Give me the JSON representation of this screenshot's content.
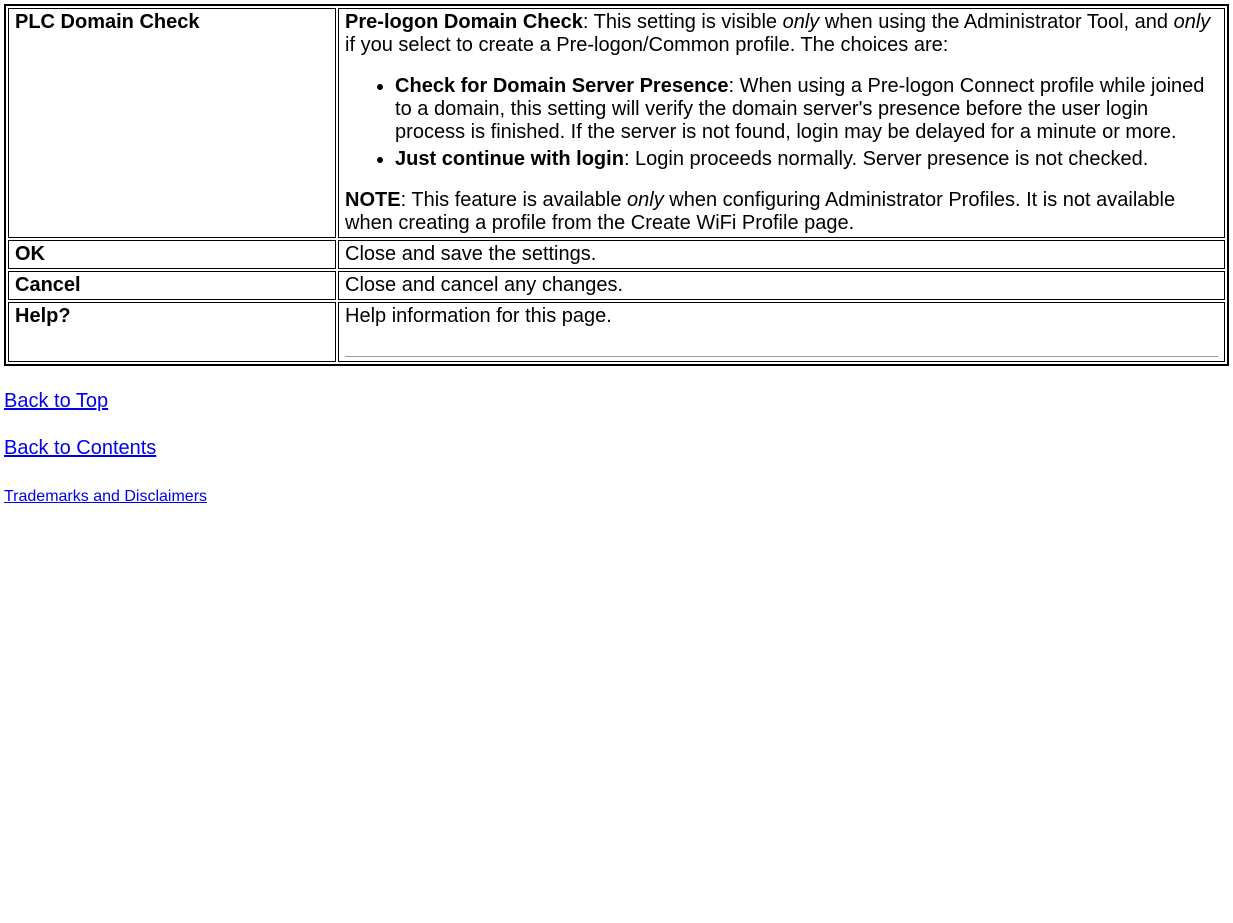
{
  "table": {
    "rows": [
      {
        "left": "PLC Domain Check",
        "right": {
          "intro_bold": "Pre-logon Domain Check",
          "intro_rest_a": ": This setting is visible ",
          "intro_only1": "only",
          "intro_rest_b": " when using the Administrator Tool, and ",
          "intro_only2": "only",
          "intro_rest_c": " if you select to create a Pre-logon/Common profile. The choices are:",
          "bullets": [
            {
              "bold": "Check for Domain Server Presence",
              "rest": ": When using a Pre-logon Connect profile while joined to a domain, this setting will verify the domain server's presence before the user login process is finished. If the server is not found, login may be delayed for a minute or more."
            },
            {
              "bold": "Just continue with login",
              "rest": ": Login proceeds normally. Server presence is not checked."
            }
          ],
          "note_bold": "NOTE",
          "note_rest_a": ": This feature is available ",
          "note_only": "only",
          "note_rest_b": " when configuring Administrator Profiles. It is not available when creating a profile from the Create WiFi Profile page."
        }
      },
      {
        "left": "OK",
        "right_text": "Close and save the settings."
      },
      {
        "left": "Cancel",
        "right_text": "Close and cancel any changes."
      },
      {
        "left": "Help?",
        "right_text": "Help information for this page.",
        "has_hr": true
      }
    ]
  },
  "links": {
    "back_to_top": "Back to Top",
    "back_to_contents": "Back to Contents",
    "trademarks": "Trademarks and Disclaimers"
  }
}
